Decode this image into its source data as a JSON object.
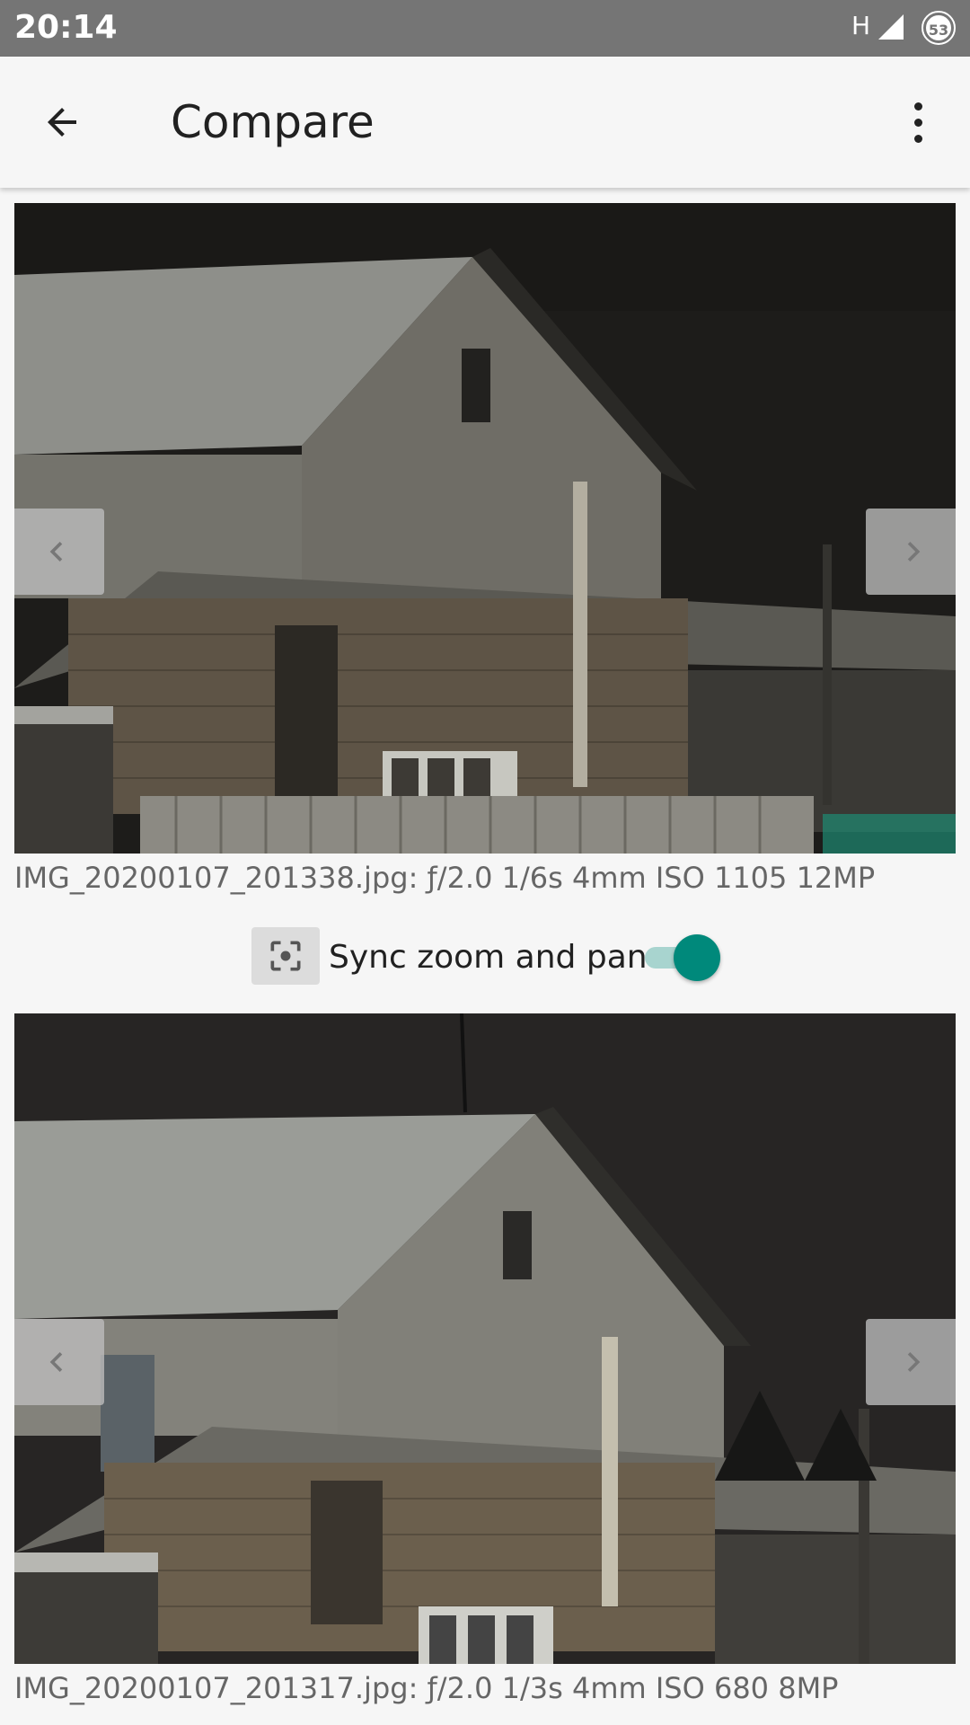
{
  "status_bar": {
    "time": "20:14",
    "network": "H",
    "notification_count": "53"
  },
  "app_bar": {
    "title": "Compare",
    "back_icon": "arrow-back-icon",
    "menu_icon": "more-vert-icon"
  },
  "images": [
    {
      "caption": "IMG_20200107_201338.jpg: ƒ/2.0 1/6s 4mm ISO 1105 12MP"
    },
    {
      "caption": "IMG_20200107_201317.jpg: ƒ/2.0 1/3s 4mm ISO 680 8MP"
    }
  ],
  "sync": {
    "label": "Sync zoom and pan",
    "icon": "center-focus-icon",
    "enabled": true,
    "accent": "#00897b"
  }
}
